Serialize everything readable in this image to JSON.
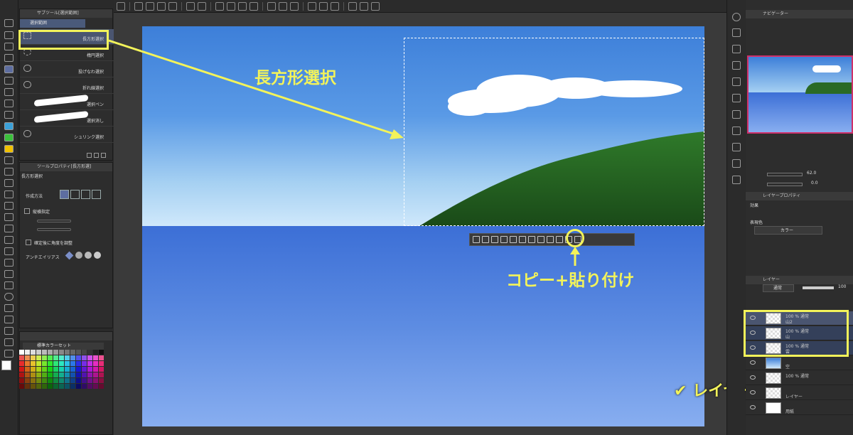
{
  "subtool": {
    "header": "サブツール[選択範囲]",
    "group": "選択範囲",
    "items": [
      {
        "label": "長方形選択",
        "selected": true
      },
      {
        "label": "楕円選択"
      },
      {
        "label": "投げなわ選択"
      },
      {
        "label": "折れ線選択"
      },
      {
        "label": "選択ペン"
      },
      {
        "label": "選択消し"
      },
      {
        "label": "シュリンク選択"
      }
    ]
  },
  "toolprop": {
    "header": "ツールプロパティ[長方形選]",
    "title": "長方形選択",
    "create_method": "作成方法",
    "aspect": "縦横指定",
    "adjust_angle": "確定後に角度を調整",
    "antialias": "アンチエイリアス"
  },
  "colorset": {
    "name": "標準カラーセット"
  },
  "navigator": {
    "header": "ナビゲーター",
    "zoom": "62.0",
    "angle": "0.0"
  },
  "layerprop": {
    "header": "レイヤープロパティ",
    "effect": "効果",
    "express_color_label": "表現色",
    "express_color": "カラー"
  },
  "layers": {
    "header": "レイヤー",
    "blend": "通常",
    "opacity": "100",
    "items": [
      {
        "line1": "100 % 通常",
        "line2": "山2"
      },
      {
        "line1": "100 % 通常",
        "line2": "山"
      },
      {
        "line1": "100 % 通常",
        "line2": "雲"
      },
      {
        "line1": "",
        "line2": "空"
      },
      {
        "line1": "100 % 通常",
        "line2": ""
      },
      {
        "line1": "",
        "line2": "レイヤー"
      },
      {
        "line1": "",
        "line2": "用紙"
      }
    ]
  },
  "annotations": {
    "rect_select": "長方形選択",
    "copy_paste": "コピー+貼り付け",
    "select_layer": "✔ レイヤーを選択"
  },
  "colors": {
    "accent": "#f3f35a"
  }
}
